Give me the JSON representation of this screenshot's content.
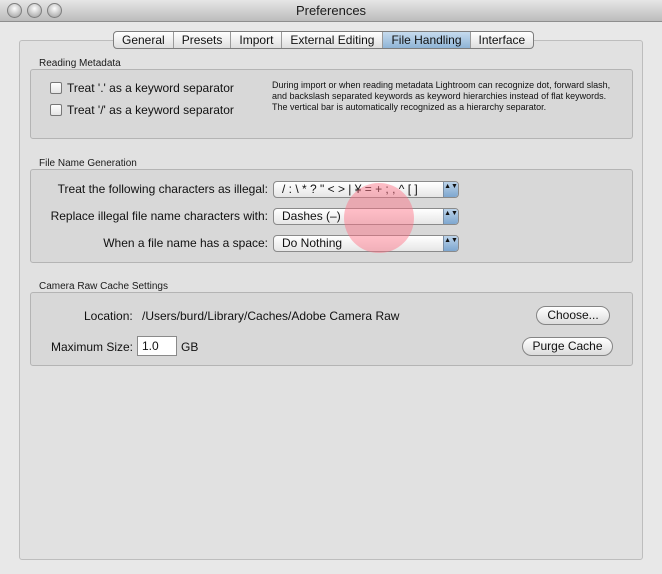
{
  "window": {
    "title": "Preferences"
  },
  "tabs": [
    {
      "label": "General"
    },
    {
      "label": "Presets"
    },
    {
      "label": "Import"
    },
    {
      "label": "External Editing"
    },
    {
      "label": "File Handling",
      "active": true
    },
    {
      "label": "Interface"
    }
  ],
  "reading_metadata": {
    "section_label": "Reading Metadata",
    "dot_checkbox_label": "Treat '.' as a keyword separator",
    "slash_checkbox_label": "Treat '/' as a keyword separator",
    "dot_checked": false,
    "slash_checked": false,
    "description": "During import or when reading metadata Lightroom can recognize dot, forward slash, and backslash separated keywords as keyword hierarchies instead of flat keywords. The vertical bar is automatically recognized as a hierarchy separator."
  },
  "file_name_generation": {
    "section_label": "File Name Generation",
    "illegal_chars_label": "Treat the following characters as illegal:",
    "illegal_chars_value": "/ : \\ * ? \" < > | ¥ = + ; , ^ [ ]",
    "replace_label": "Replace illegal file name characters with:",
    "replace_value": "Dashes (–)",
    "space_label": "When a file name has a space:",
    "space_value": "Do Nothing"
  },
  "camera_raw_cache": {
    "section_label": "Camera Raw Cache Settings",
    "location_label": "Location:",
    "location_value": "/Users/burd/Library/Caches/Adobe Camera Raw",
    "choose_button": "Choose...",
    "max_size_label": "Maximum Size:",
    "max_size_value": "1.0",
    "max_size_unit": "GB",
    "purge_button": "Purge Cache"
  },
  "icons": {
    "popup_arrows": "up-down-arrows-icon",
    "arrows_glyph": "▲▼"
  }
}
